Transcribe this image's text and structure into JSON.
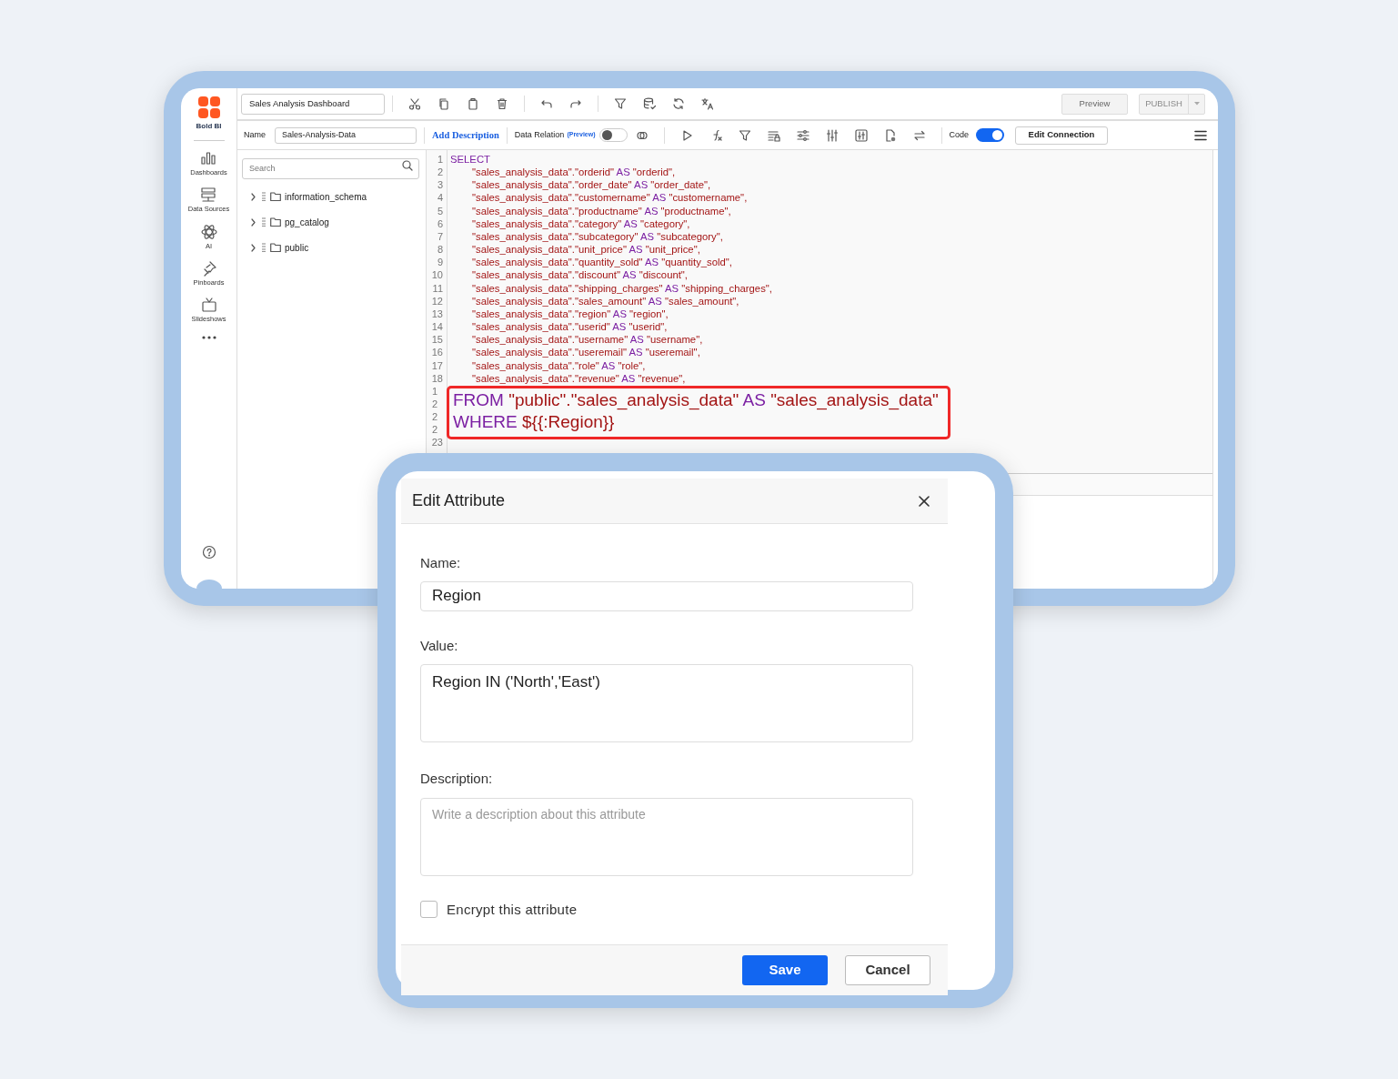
{
  "sidebar": {
    "logo_label": "Bold BI",
    "items": [
      {
        "label": "Dashboards"
      },
      {
        "label": "Data Sources"
      },
      {
        "label": "AI"
      },
      {
        "label": "Pinboards"
      },
      {
        "label": "Slideshows"
      }
    ]
  },
  "toolbar": {
    "dashboard_name": "Sales Analysis Dashboard",
    "preview": "Preview",
    "publish": "PUBLISH"
  },
  "datasource_bar": {
    "name_label": "Name",
    "name_value": "Sales-Analysis-Data",
    "add_description": "Add Description",
    "data_relation": "Data Relation",
    "preview_badge": "(Preview)",
    "data_relation_on": false,
    "code_label": "Code",
    "code_on": true,
    "edit_connection": "Edit Connection"
  },
  "schema_tree": {
    "search_placeholder": "Search",
    "items": [
      {
        "label": "information_schema",
        "expanded": false
      },
      {
        "label": "pg_catalog",
        "expanded": false
      },
      {
        "label": "public",
        "expanded": false
      }
    ]
  },
  "editor": {
    "lines": [
      {
        "number": "1",
        "code": "SELECT",
        "indent": false
      },
      {
        "number": "2",
        "code": "\"sales_analysis_data\".\"orderid\" AS \"orderid\",",
        "indent": true
      },
      {
        "number": "3",
        "code": "\"sales_analysis_data\".\"order_date\" AS \"order_date\",",
        "indent": true
      },
      {
        "number": "4",
        "code": "\"sales_analysis_data\".\"customername\" AS \"customername\",",
        "indent": true
      },
      {
        "number": "5",
        "code": "\"sales_analysis_data\".\"productname\" AS \"productname\",",
        "indent": true
      },
      {
        "number": "6",
        "code": "\"sales_analysis_data\".\"category\" AS \"category\",",
        "indent": true
      },
      {
        "number": "7",
        "code": "\"sales_analysis_data\".\"subcategory\" AS \"subcategory\",",
        "indent": true
      },
      {
        "number": "8",
        "code": "\"sales_analysis_data\".\"unit_price\" AS \"unit_price\",",
        "indent": true
      },
      {
        "number": "9",
        "code": "\"sales_analysis_data\".\"quantity_sold\" AS \"quantity_sold\",",
        "indent": true
      },
      {
        "number": "10",
        "code": "\"sales_analysis_data\".\"discount\" AS \"discount\",",
        "indent": true
      },
      {
        "number": "11",
        "code": "\"sales_analysis_data\".\"shipping_charges\" AS \"shipping_charges\",",
        "indent": true
      },
      {
        "number": "12",
        "code": "\"sales_analysis_data\".\"sales_amount\" AS \"sales_amount\",",
        "indent": true
      },
      {
        "number": "13",
        "code": "\"sales_analysis_data\".\"region\" AS \"region\",",
        "indent": true
      },
      {
        "number": "14",
        "code": "\"sales_analysis_data\".\"userid\" AS \"userid\",",
        "indent": true
      },
      {
        "number": "15",
        "code": "\"sales_analysis_data\".\"username\" AS \"username\",",
        "indent": true
      },
      {
        "number": "16",
        "code": "\"sales_analysis_data\".\"useremail\" AS \"useremail\",",
        "indent": true
      },
      {
        "number": "17",
        "code": "\"sales_analysis_data\".\"role\" AS \"role\",",
        "indent": true
      },
      {
        "number": "18",
        "code": "\"sales_analysis_data\".\"revenue\" AS \"revenue\",",
        "indent": true
      }
    ],
    "covered_numbers": [
      "1",
      "2",
      "2",
      "2"
    ],
    "last_number": "23",
    "highlight": [
      "FROM \"public\".\"sales_analysis_data\" AS \"sales_analysis_data\"",
      "WHERE ${{:Region}}"
    ]
  },
  "dialog": {
    "title": "Edit Attribute",
    "name_label": "Name:",
    "name_value": "Region",
    "value_label": "Value:",
    "value_value": "Region IN ('North','East')",
    "description_label": "Description:",
    "description_placeholder": "Write a description about this attribute",
    "encrypt_label": "Encrypt this attribute",
    "encrypt_checked": false,
    "save": "Save",
    "cancel": "Cancel"
  }
}
